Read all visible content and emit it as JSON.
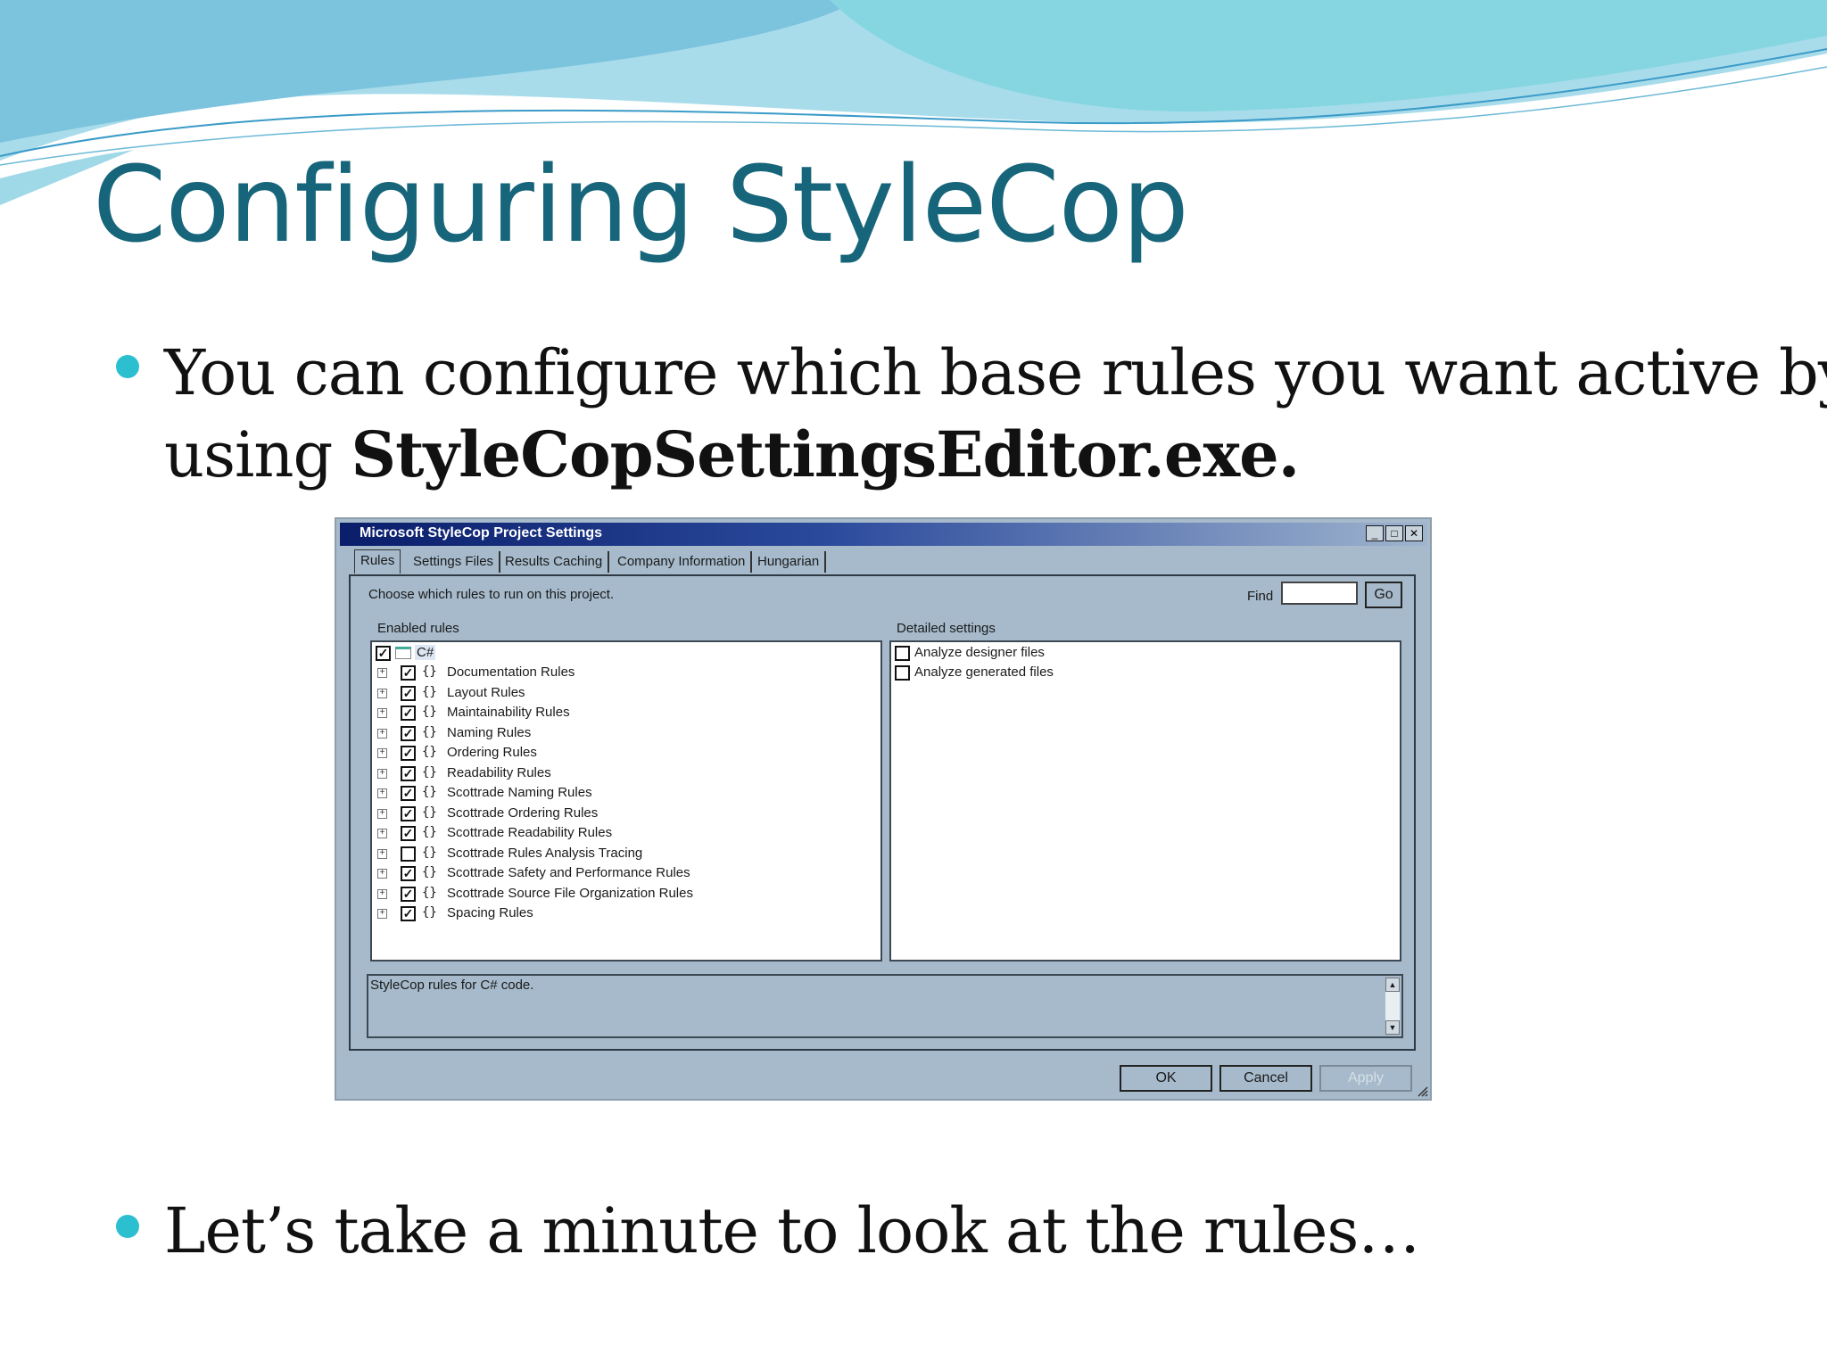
{
  "slide": {
    "title": "Configuring StyleCop",
    "bullets": [
      {
        "prefix_line1": "You can configure which base rules you want active by",
        "prefix_line2": "using ",
        "emphasis": "StyleCopSettingsEditor.exe."
      },
      {
        "text": "Let’s take a minute to look at the rules…"
      }
    ],
    "colors": {
      "title": "#17657a",
      "bullet": "#2bbfd0",
      "wave_light": "#8fd6e3",
      "wave_dark": "#4aa6cf"
    }
  },
  "dialog": {
    "title": "Microsoft StyleCop Project Settings",
    "window_buttons": [
      "_",
      "□",
      "✕"
    ],
    "tabs": [
      "Rules",
      "Settings Files",
      "Results Caching",
      "Company Information",
      "Hungarian"
    ],
    "active_tab": "Rules",
    "instruction": "Choose which rules to run on this project.",
    "find_label": "Find",
    "find_value": "",
    "go_label": "Go",
    "enabled_rules_label": "Enabled rules",
    "detailed_settings_label": "Detailed settings",
    "root": {
      "label": "C#",
      "checked": true
    },
    "rules": [
      {
        "label": "Documentation Rules",
        "checked": true
      },
      {
        "label": "Layout Rules",
        "checked": true
      },
      {
        "label": "Maintainability Rules",
        "checked": true
      },
      {
        "label": "Naming Rules",
        "checked": true
      },
      {
        "label": "Ordering Rules",
        "checked": true
      },
      {
        "label": "Readability Rules",
        "checked": true
      },
      {
        "label": "Scottrade Naming Rules",
        "checked": true
      },
      {
        "label": "Scottrade Ordering Rules",
        "checked": true
      },
      {
        "label": "Scottrade Readability Rules",
        "checked": true
      },
      {
        "label": "Scottrade Rules Analysis Tracing",
        "checked": false
      },
      {
        "label": "Scottrade Safety and Performance Rules",
        "checked": true
      },
      {
        "label": "Scottrade Source File Organization Rules",
        "checked": true
      },
      {
        "label": "Spacing Rules",
        "checked": true
      }
    ],
    "details": [
      {
        "label": "Analyze designer files",
        "checked": false
      },
      {
        "label": "Analyze generated files",
        "checked": false
      }
    ],
    "description": "StyleCop rules for C# code.",
    "buttons": {
      "ok": "OK",
      "cancel": "Cancel",
      "apply": "Apply"
    }
  }
}
